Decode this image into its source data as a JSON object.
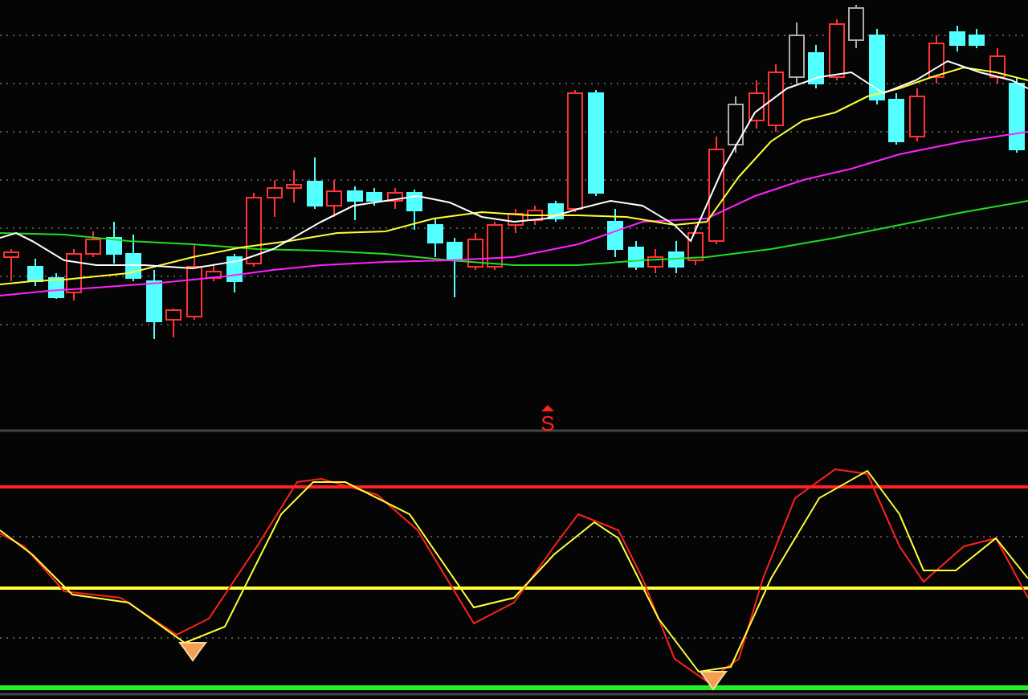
{
  "indicator_panel": {
    "label": "S"
  }
}
